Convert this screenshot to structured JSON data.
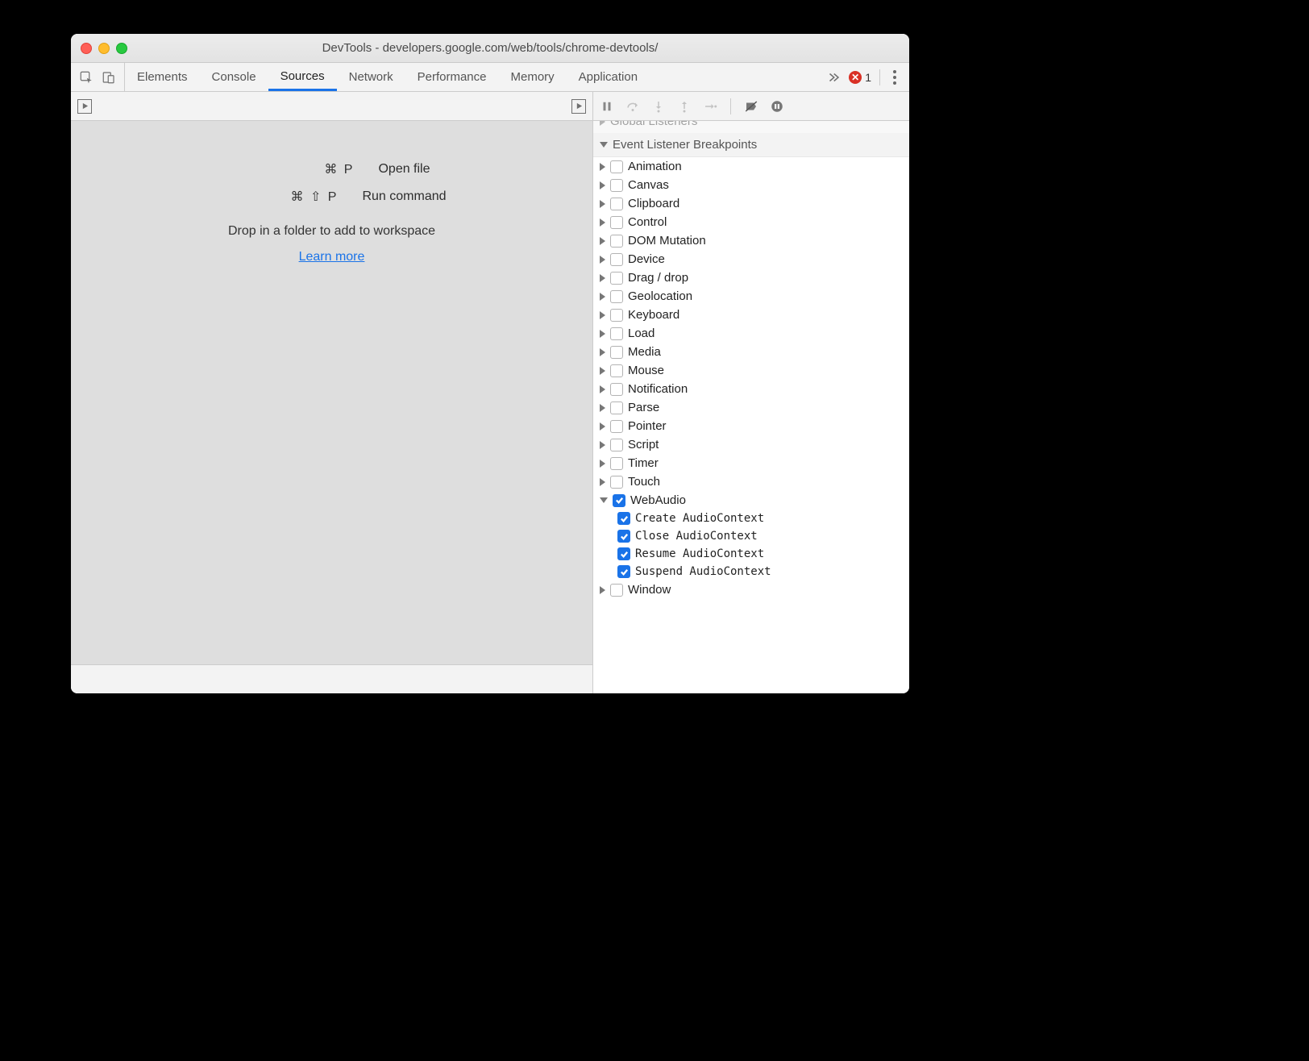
{
  "window": {
    "title": "DevTools - developers.google.com/web/tools/chrome-devtools/"
  },
  "tabs": {
    "items": [
      "Elements",
      "Console",
      "Sources",
      "Network",
      "Performance",
      "Memory",
      "Application"
    ],
    "active": "Sources",
    "error_count": "1"
  },
  "sources_empty": {
    "open_file_keys": "⌘ P",
    "open_file_label": "Open file",
    "run_cmd_keys": "⌘ ⇧ P",
    "run_cmd_label": "Run command",
    "drop_msg": "Drop in a folder to add to workspace",
    "learn_more": "Learn more"
  },
  "sidebar": {
    "clipped_section": "Global Listeners",
    "section_title": "Event Listener Breakpoints",
    "categories": [
      {
        "label": "Animation",
        "checked": false,
        "expanded": false
      },
      {
        "label": "Canvas",
        "checked": false,
        "expanded": false
      },
      {
        "label": "Clipboard",
        "checked": false,
        "expanded": false
      },
      {
        "label": "Control",
        "checked": false,
        "expanded": false
      },
      {
        "label": "DOM Mutation",
        "checked": false,
        "expanded": false
      },
      {
        "label": "Device",
        "checked": false,
        "expanded": false
      },
      {
        "label": "Drag / drop",
        "checked": false,
        "expanded": false
      },
      {
        "label": "Geolocation",
        "checked": false,
        "expanded": false
      },
      {
        "label": "Keyboard",
        "checked": false,
        "expanded": false
      },
      {
        "label": "Load",
        "checked": false,
        "expanded": false
      },
      {
        "label": "Media",
        "checked": false,
        "expanded": false
      },
      {
        "label": "Mouse",
        "checked": false,
        "expanded": false
      },
      {
        "label": "Notification",
        "checked": false,
        "expanded": false
      },
      {
        "label": "Parse",
        "checked": false,
        "expanded": false
      },
      {
        "label": "Pointer",
        "checked": false,
        "expanded": false
      },
      {
        "label": "Script",
        "checked": false,
        "expanded": false
      },
      {
        "label": "Timer",
        "checked": false,
        "expanded": false
      },
      {
        "label": "Touch",
        "checked": false,
        "expanded": false
      },
      {
        "label": "WebAudio",
        "checked": true,
        "expanded": true,
        "children": [
          {
            "label": "Create AudioContext",
            "checked": true
          },
          {
            "label": "Close AudioContext",
            "checked": true
          },
          {
            "label": "Resume AudioContext",
            "checked": true
          },
          {
            "label": "Suspend AudioContext",
            "checked": true
          }
        ]
      },
      {
        "label": "Window",
        "checked": false,
        "expanded": false
      }
    ]
  }
}
